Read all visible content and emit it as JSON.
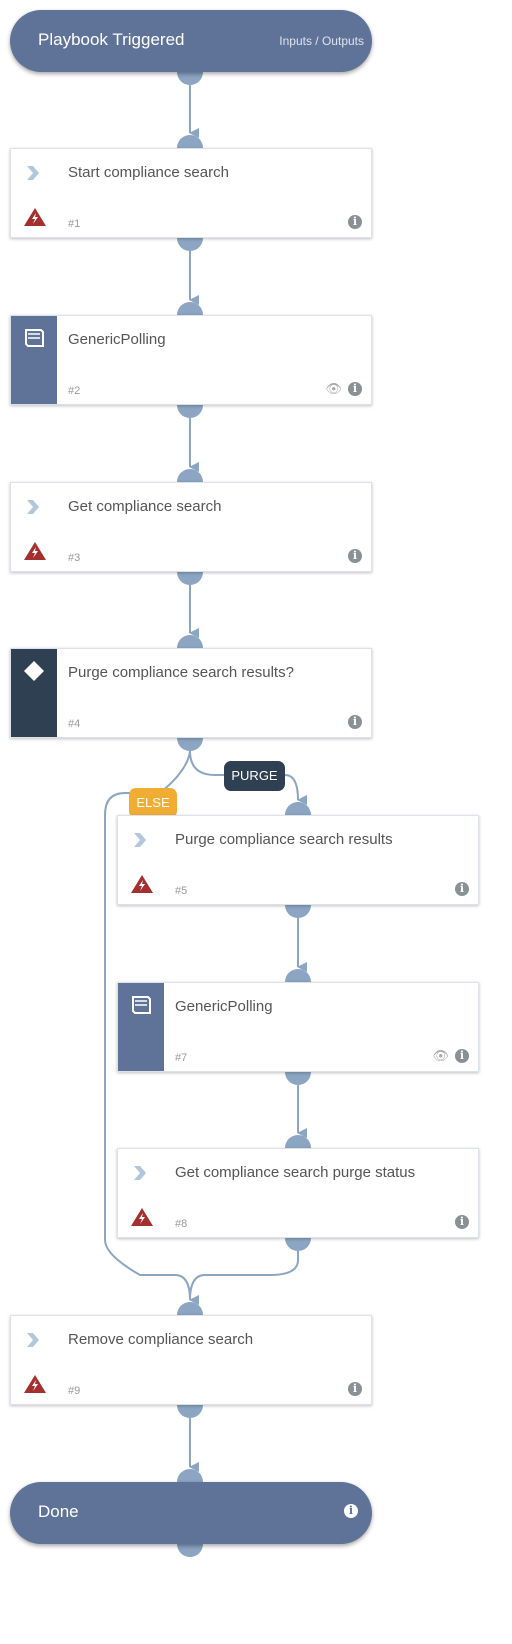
{
  "start": {
    "title": "Playbook Triggered",
    "io_link": "Inputs / Outputs"
  },
  "nodes": [
    {
      "title": "Start compliance search",
      "num": "#1",
      "type": "automation"
    },
    {
      "title": "GenericPolling",
      "num": "#2",
      "type": "playbook"
    },
    {
      "title": "Get compliance search",
      "num": "#3",
      "type": "automation"
    },
    {
      "title": "Purge compliance search results?",
      "num": "#4",
      "type": "condition"
    },
    {
      "title": "Purge compliance search results",
      "num": "#5",
      "type": "automation"
    },
    {
      "title": "GenericPolling",
      "num": "#7",
      "type": "playbook"
    },
    {
      "title": "Get compliance search purge status",
      "num": "#8",
      "type": "automation"
    },
    {
      "title": "Remove compliance search",
      "num": "#9",
      "type": "automation"
    }
  ],
  "branches": {
    "purge": "PURGE",
    "else": "ELSE"
  },
  "end": {
    "title": "Done"
  },
  "colors": {
    "header": "#5f7399",
    "condition": "#2e4052",
    "edge": "#8ba5c3",
    "else": "#f0ad33",
    "warning": "#a3302e"
  }
}
